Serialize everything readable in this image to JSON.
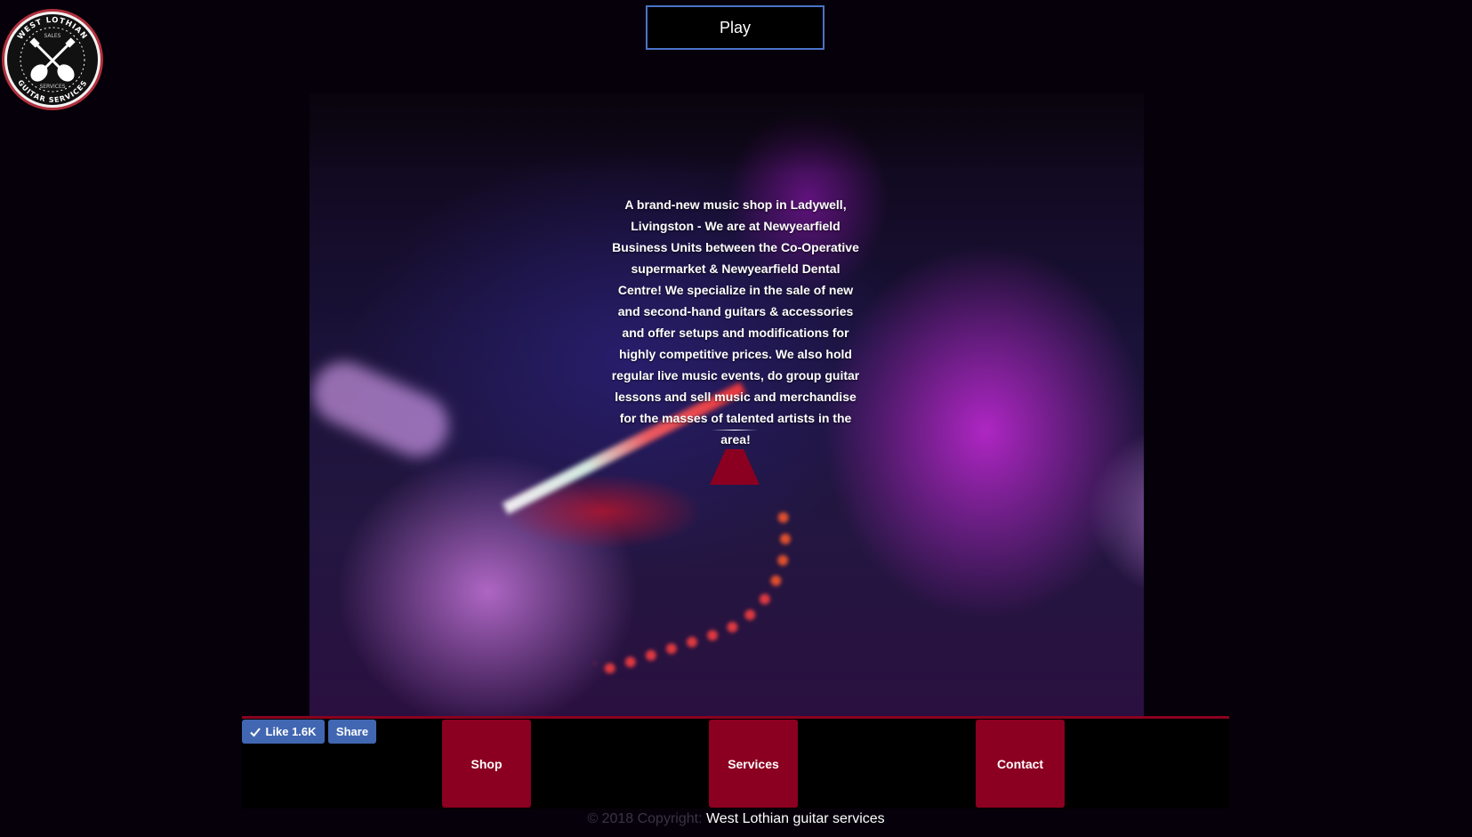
{
  "logo": {
    "top_text": "WEST LOTHIAN",
    "bottom_text": "GUITAR SERVICES",
    "inner_top": "SALES",
    "inner_bottom": "SERVICES"
  },
  "player": {
    "play_label": "Play"
  },
  "hero": {
    "description": "A brand-new music shop in Ladywell, Livingston - We are at Newyearfield Business Units between the Co-Operative supermarket & Newyearfield Dental Centre! We specialize in the sale of new and second-hand guitars & accessories and offer setups and modifications for highly competitive prices. We also hold regular live music events, do group guitar lessons and sell music and merchandise for the masses of talented artists in the area!"
  },
  "facebook": {
    "like_label": "Like 1.6K",
    "share_label": "Share"
  },
  "nav": {
    "shop_label": "Shop",
    "services_label": "Services",
    "contact_label": "Contact"
  },
  "footer": {
    "copyright_prefix": "© 2018 Copyright:",
    "owner_name": "West Lothian guitar services"
  },
  "colors": {
    "accent": "#8b0020",
    "facebook": "#4267b2",
    "play_border": "#4a73c9",
    "background": "#06000a"
  }
}
